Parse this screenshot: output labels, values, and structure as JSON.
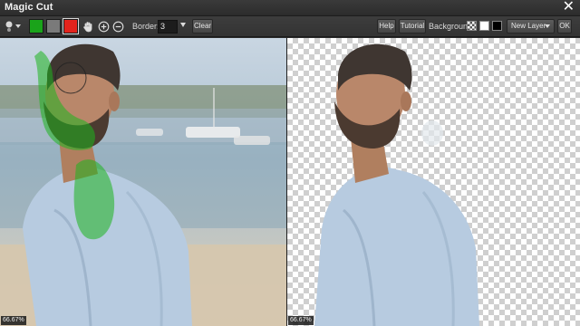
{
  "window": {
    "title": "Magic Cut",
    "close_icon": "close-icon"
  },
  "toolbar": {
    "brush_icon": "brush-size-icon",
    "swatches": [
      {
        "name": "keep",
        "color": "#1aa31a"
      },
      {
        "name": "neutral",
        "color": "#7a7a7a"
      },
      {
        "name": "remove",
        "color": "#e3231c",
        "selected": true
      }
    ],
    "tools": [
      "hand-icon",
      "zoom-in-icon",
      "zoom-out-icon"
    ],
    "border_label": "Border:",
    "border_value": "3",
    "clear_label": "Clear",
    "help_label": "Help",
    "tutorial_label": "Tutorial",
    "background_label": "Background:",
    "background_options": [
      {
        "name": "transparent",
        "color": "checker"
      },
      {
        "name": "white",
        "color": "#ffffff"
      },
      {
        "name": "black",
        "color": "#000000"
      }
    ],
    "new_layer_label": "New Layer",
    "ok_label": "OK"
  },
  "panels": {
    "left_zoom": "66.67%",
    "right_zoom": "66.67%"
  }
}
